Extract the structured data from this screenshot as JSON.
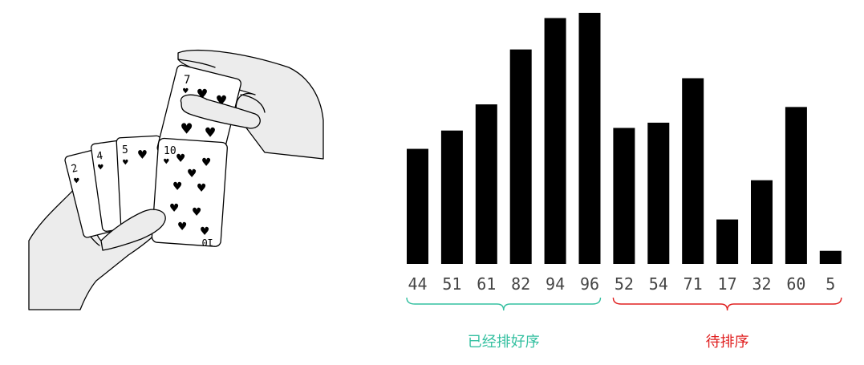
{
  "chart_data": {
    "type": "bar",
    "categories": [
      "44",
      "51",
      "61",
      "82",
      "94",
      "96",
      "52",
      "54",
      "71",
      "17",
      "32",
      "60",
      "5"
    ],
    "values": [
      44,
      51,
      61,
      82,
      94,
      96,
      52,
      54,
      71,
      17,
      32,
      60,
      5
    ],
    "bar_color": "#000000",
    "groups": [
      {
        "label": "已经排好序",
        "start": 0,
        "end": 5,
        "color": "#34c0a0"
      },
      {
        "label": "待排序",
        "start": 6,
        "end": 12,
        "color": "#e02020"
      }
    ]
  },
  "illustration": {
    "cards": [
      "2",
      "4",
      "5",
      "7",
      "10"
    ],
    "card_suit": "heart"
  }
}
